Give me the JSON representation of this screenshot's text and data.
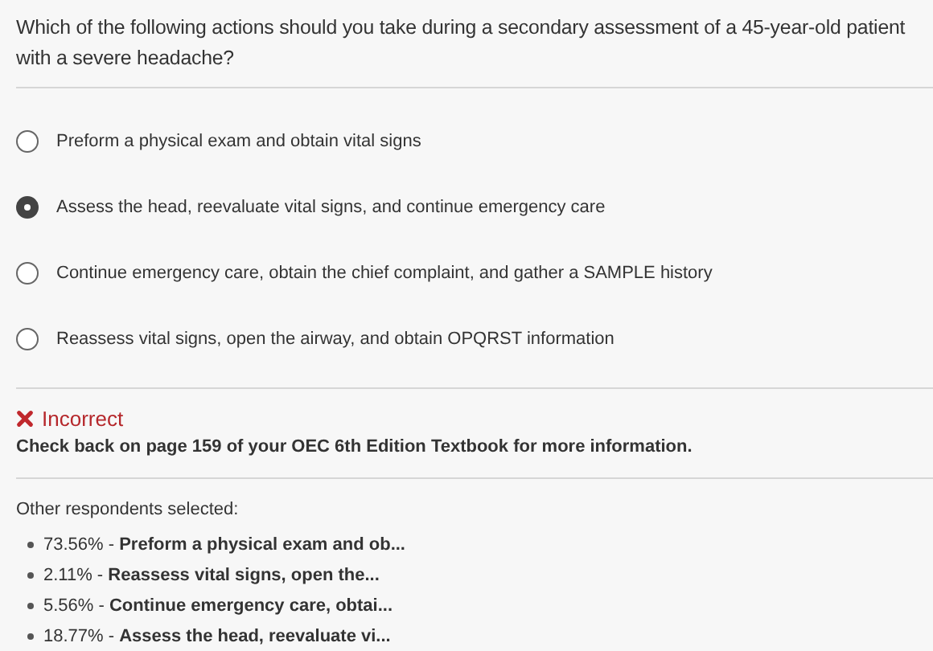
{
  "question": "Which of the following actions should you take during a secondary assessment of a 45-year-old patient with a severe headache?",
  "options": [
    {
      "label": "Preform a physical exam and obtain vital signs",
      "selected": false
    },
    {
      "label": "Assess the head, reevaluate vital signs, and continue emergency care",
      "selected": true
    },
    {
      "label": "Continue emergency care, obtain the chief complaint, and gather a SAMPLE history",
      "selected": false
    },
    {
      "label": "Reassess vital signs, open the airway, and obtain OPQRST information",
      "selected": false
    }
  ],
  "feedback": {
    "correct": false,
    "title": "Incorrect",
    "message": "Check back on page 159 of your OEC 6th Edition Textbook for more information."
  },
  "respondents": {
    "heading": "Other respondents selected:",
    "items": [
      {
        "percent": "73.56% -",
        "answer": "Preform a physical exam and ob..."
      },
      {
        "percent": "2.11% -",
        "answer": "Reassess vital signs, open the..."
      },
      {
        "percent": "5.56% -",
        "answer": "Continue emergency care, obtai..."
      },
      {
        "percent": "18.77% -",
        "answer": "Assess the head, reevaluate vi..."
      }
    ]
  }
}
